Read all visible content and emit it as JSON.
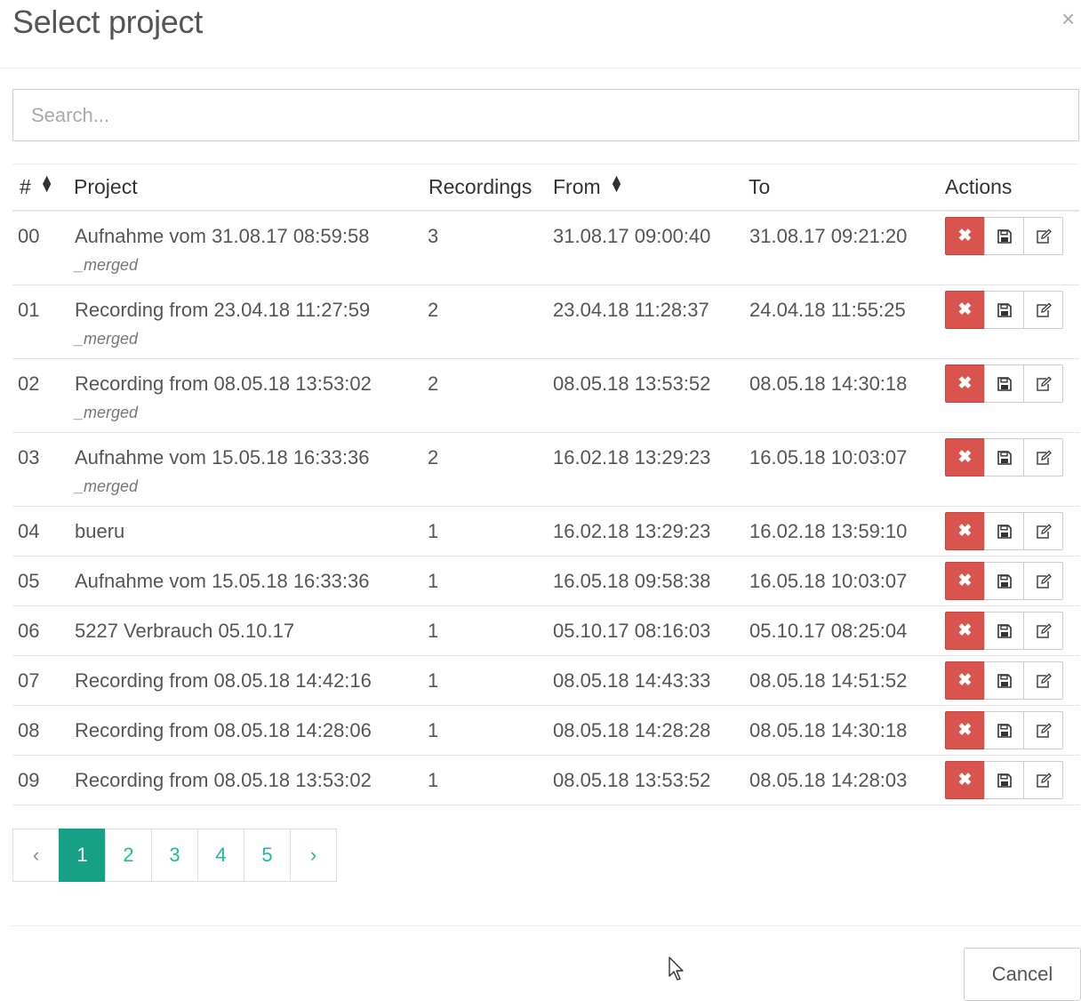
{
  "modal": {
    "title": "Select project",
    "close": "×"
  },
  "search": {
    "placeholder": "Search..."
  },
  "table": {
    "columns": [
      "#",
      "Project",
      "Recordings",
      "From",
      "To",
      "Actions"
    ],
    "rows": [
      {
        "num": "00",
        "project": "Aufnahme vom 31.08.17 08:59:58",
        "sub": "_merged",
        "recordings": "3",
        "from": "31.08.17 09:00:40",
        "to": "31.08.17 09:21:20"
      },
      {
        "num": "01",
        "project": "Recording from 23.04.18 11:27:59",
        "sub": "_merged",
        "recordings": "2",
        "from": "23.04.18 11:28:37",
        "to": "24.04.18 11:55:25"
      },
      {
        "num": "02",
        "project": "Recording from 08.05.18 13:53:02",
        "sub": "_merged",
        "recordings": "2",
        "from": "08.05.18 13:53:52",
        "to": "08.05.18 14:30:18"
      },
      {
        "num": "03",
        "project": "Aufnahme vom 15.05.18 16:33:36",
        "sub": "_merged",
        "recordings": "2",
        "from": "16.02.18 13:29:23",
        "to": "16.05.18 10:03:07"
      },
      {
        "num": "04",
        "project": "bueru",
        "sub": "",
        "recordings": "1",
        "from": "16.02.18 13:29:23",
        "to": "16.02.18 13:59:10"
      },
      {
        "num": "05",
        "project": "Aufnahme vom 15.05.18 16:33:36",
        "sub": "",
        "recordings": "1",
        "from": "16.05.18 09:58:38",
        "to": "16.05.18 10:03:07"
      },
      {
        "num": "06",
        "project": "5227 Verbrauch 05.10.17",
        "sub": "",
        "recordings": "1",
        "from": "05.10.17 08:16:03",
        "to": "05.10.17 08:25:04"
      },
      {
        "num": "07",
        "project": "Recording from 08.05.18 14:42:16",
        "sub": "",
        "recordings": "1",
        "from": "08.05.18 14:43:33",
        "to": "08.05.18 14:51:52"
      },
      {
        "num": "08",
        "project": "Recording from 08.05.18 14:28:06",
        "sub": "",
        "recordings": "1",
        "from": "08.05.18 14:28:28",
        "to": "08.05.18 14:30:18"
      },
      {
        "num": "09",
        "project": "Recording from 08.05.18 13:53:02",
        "sub": "",
        "recordings": "1",
        "from": "08.05.18 13:53:52",
        "to": "08.05.18 14:28:03"
      }
    ],
    "actions": {
      "delete_icon": "times-icon",
      "save_icon": "floppy-disk-icon",
      "edit_icon": "edit-icon"
    }
  },
  "pagination": {
    "prev": "‹",
    "pages": [
      "1",
      "2",
      "3",
      "4",
      "5"
    ],
    "active": "1",
    "next": "›"
  },
  "footer": {
    "cancel_label": "Cancel"
  },
  "colors": {
    "danger": "#d9534f",
    "accent": "#16a085",
    "link": "#1abc9c"
  }
}
